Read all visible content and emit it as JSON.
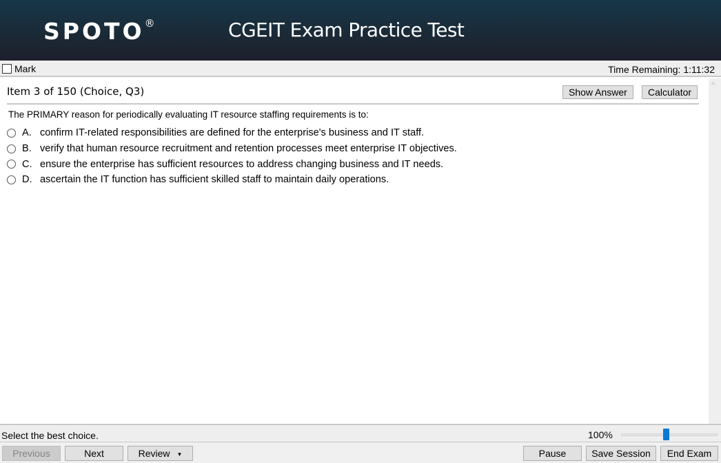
{
  "header": {
    "logo_text": "SPOTO",
    "logo_mark": "®",
    "title": "CGEIT Exam Practice Test"
  },
  "topbar": {
    "mark_label": "Mark",
    "mark_checked": false,
    "time_remaining": "Time Remaining: 1:11:32"
  },
  "item": {
    "title": "Item 3 of 150 (Choice, Q3)",
    "show_answer_label": "Show Answer",
    "calculator_label": "Calculator"
  },
  "question": {
    "text": "The PRIMARY reason for periodically evaluating IT resource staffing requirements is to:",
    "options": [
      {
        "letter": "A.",
        "text": "confirm IT-related responsibilities are defined for the enterprise's business and IT staff."
      },
      {
        "letter": "B.",
        "text": "verify that human resource recruitment and retention processes meet enterprise IT objectives."
      },
      {
        "letter": "C.",
        "text": "ensure the enterprise has sufficient resources to address changing business and IT needs."
      },
      {
        "letter": "D.",
        "text": "ascertain the IT function has sufficient skilled staff to maintain daily operations."
      }
    ]
  },
  "statusbar": {
    "instruction": "Select the best choice.",
    "zoom_level": "100%",
    "zoom_slider_fraction": 0.47
  },
  "navbar": {
    "previous_label": "Previous",
    "next_label": "Next",
    "review_label": "Review",
    "review_caret": "▼",
    "pause_label": "Pause",
    "save_session_label": "Save Session",
    "end_exam_label": "End Exam"
  },
  "icons": {
    "scroll_up": "^"
  },
  "colors": {
    "header_top": "#15374a",
    "header_bottom": "#1d1f2b",
    "slider_thumb": "#0a78d7",
    "disabled_text": "#838383"
  }
}
